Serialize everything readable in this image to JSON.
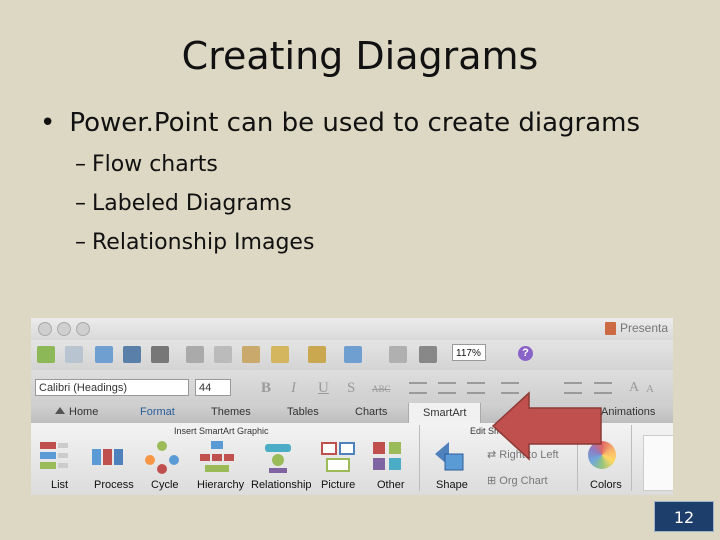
{
  "slide": {
    "title": "Creating Diagrams",
    "bullet": "Power.Point can be used to create diagrams",
    "subbullets": [
      "Flow charts",
      "Labeled Diagrams",
      "Relationship Images"
    ],
    "page_number": "12"
  },
  "app": {
    "window_title": "Presenta",
    "zoom": "117%",
    "font_name": "Calibri (Headings)",
    "font_size": "44",
    "format_buttons": [
      "B",
      "I",
      "U",
      "S",
      "ABC"
    ],
    "tabs": [
      "Home",
      "Format",
      "Themes",
      "Tables",
      "Charts",
      "SmartArt",
      "Animations"
    ],
    "ribbon": {
      "group_insert": "Insert SmartArt Graphic",
      "group_edit": "Edit Smart",
      "insert_items": [
        "List",
        "Process",
        "Cycle",
        "Hierarchy",
        "Relationship",
        "Picture",
        "Other"
      ],
      "shape": "Shape",
      "right_to_left": "Right to Left",
      "org_chart": "Org Chart",
      "colors": "Colors"
    }
  },
  "colors": {
    "slide_bg": "#ddd8c4",
    "arrow": "#c0504d",
    "page_badge": "#1d3d6b"
  }
}
